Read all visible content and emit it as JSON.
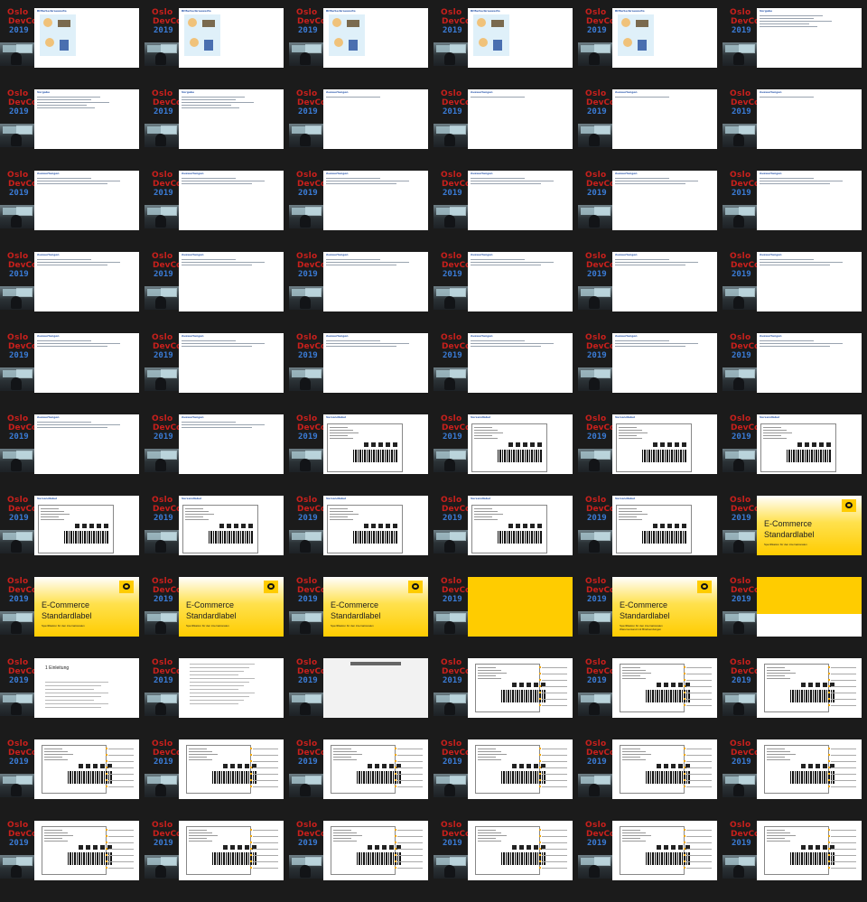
{
  "header": {
    "logo_line1": "Oslo",
    "logo_line2": "DevCon",
    "logo_year": "2019"
  },
  "frame_types": [
    "comic",
    "bullets",
    "bullets2",
    "blank",
    "label",
    "yellow_title",
    "yellow_blank",
    "yellow_title2",
    "yellow_white",
    "doc_intro",
    "doc_text",
    "doc_grey",
    "label_split"
  ],
  "slides": {
    "comic": {
      "title": "Bitfarbe/Grauwerte"
    },
    "bullets": {
      "title": "Vorgabe"
    },
    "blank": {
      "title": "Auswertungen"
    },
    "label": {
      "title": "Versandlabel"
    },
    "yellow_title": {
      "line1": "E-Commerce",
      "line2": "Standardlabel",
      "sub": "Spezifikation für den internationalen"
    },
    "yellow_title2": {
      "line1": "E-Commerce",
      "line2": "Standardlabel",
      "sub1": "Spezifikation für den internationalen",
      "sub2": "Warenversand mit Briefsendungen"
    },
    "doc_intro": {
      "heading": "1 Einleitung"
    },
    "label_split": {}
  },
  "rows": [
    [
      "comic",
      "comic",
      "comic",
      "comic",
      "comic",
      "bullets"
    ],
    [
      "bullets",
      "bullets",
      "blank",
      "blank",
      "blank",
      "blank"
    ],
    [
      "blank",
      "blank",
      "blank",
      "blank",
      "blank",
      "blank"
    ],
    [
      "blank",
      "blank",
      "blank",
      "blank",
      "blank",
      "blank"
    ],
    [
      "blank",
      "blank",
      "blank",
      "blank",
      "blank",
      "blank"
    ],
    [
      "blank",
      "blank",
      "label",
      "label",
      "label",
      "label"
    ],
    [
      "label",
      "label",
      "label",
      "label",
      "label",
      "yellow_title"
    ],
    [
      "yellow_title",
      "yellow_title",
      "yellow_title",
      "yellow_blank",
      "yellow_title2",
      "yellow_white"
    ],
    [
      "doc_intro",
      "doc_text",
      "doc_grey",
      "label_split",
      "label_split",
      "label_split"
    ],
    [
      "label_split",
      "label_split",
      "label_split",
      "label_split",
      "label_split",
      "label_split"
    ],
    [
      "label_split",
      "label_split",
      "label_split",
      "label_split",
      "label_split",
      "label_split"
    ]
  ]
}
